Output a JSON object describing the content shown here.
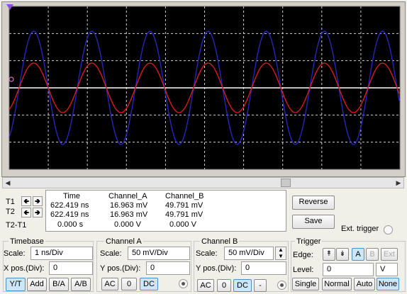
{
  "screen": {
    "colors": {
      "background": "#000000",
      "grid": "#cfcfcf",
      "channel_a": "#e02020",
      "channel_b": "#2828c8",
      "baseline": "#ffffff"
    }
  },
  "cursors": {
    "t1": {
      "label": "T1"
    },
    "t2": {
      "label": "T2"
    },
    "diff": {
      "label": "T2-T1"
    },
    "columns": [
      "Time",
      "Channel_A",
      "Channel_B"
    ],
    "rows": [
      [
        "622.419 ns",
        "16.963 mV",
        "49.791 mV"
      ],
      [
        "622.419 ns",
        "16.963 mV",
        "49.791 mV"
      ],
      [
        "0.000 s",
        "0.000 V",
        "0.000 V"
      ]
    ]
  },
  "actions": {
    "reverse": "Reverse",
    "save": "Save",
    "ext_trigger": "Ext. trigger"
  },
  "timebase": {
    "title": "Timebase",
    "scale_label": "Scale:",
    "scale_value": "1 ns/Div",
    "xpos_label": "X pos.(Div):",
    "xpos_value": "0",
    "modes": [
      "Y/T",
      "Add",
      "B/A",
      "A/B"
    ],
    "active_mode": "Y/T"
  },
  "channel_a": {
    "title": "Channel A",
    "scale_label": "Scale:",
    "scale_value": "50 mV/Div",
    "ypos_label": "Y pos.(Div):",
    "ypos_value": "0",
    "coupling": [
      "AC",
      "0",
      "DC"
    ],
    "active_coupling": "DC"
  },
  "channel_b": {
    "title": "Channel B",
    "scale_label": "Scale:",
    "scale_value": "50 mV/Div",
    "ypos_label": "Y pos.(Div):",
    "ypos_value": "0",
    "coupling": [
      "AC",
      "0",
      "DC",
      "-"
    ],
    "active_coupling": "DC"
  },
  "trigger": {
    "title": "Trigger",
    "edge_label": "Edge:",
    "edge_sources": [
      "A",
      "B",
      "Ext"
    ],
    "active_source": "A",
    "level_label": "Level:",
    "level_value": "0",
    "level_unit": "V",
    "modes": [
      "Single",
      "Normal",
      "Auto",
      "None"
    ],
    "active_mode": "None"
  }
}
